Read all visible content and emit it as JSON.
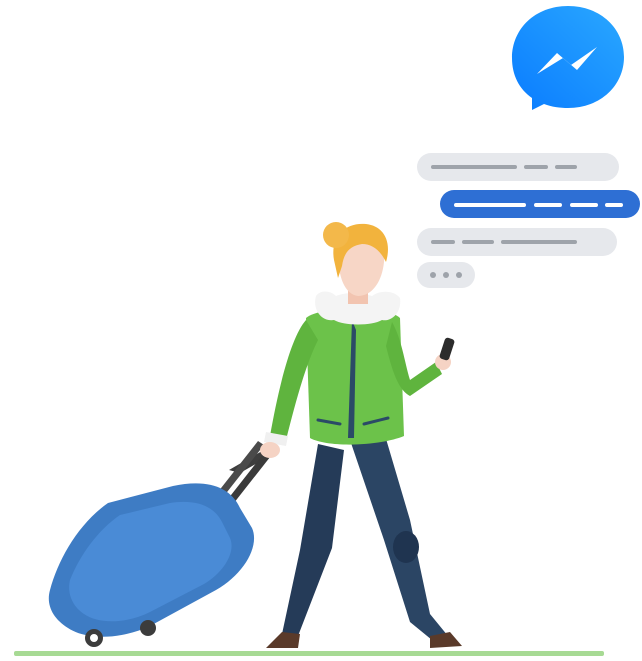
{
  "illustration": {
    "icon": "messenger-icon",
    "brand_color": "#1E88F5",
    "bubble_color": "#E4E6EB",
    "accent_bubble_color": "#2E6FD4",
    "jacket_color": "#6CC24A",
    "luggage_color": "#3E7CC4",
    "hair_color": "#F2B33D",
    "ground_color": "#9ED68B",
    "chat_rows": [
      {
        "kind": "incoming"
      },
      {
        "kind": "outgoing"
      },
      {
        "kind": "incoming"
      },
      {
        "kind": "typing"
      }
    ]
  }
}
